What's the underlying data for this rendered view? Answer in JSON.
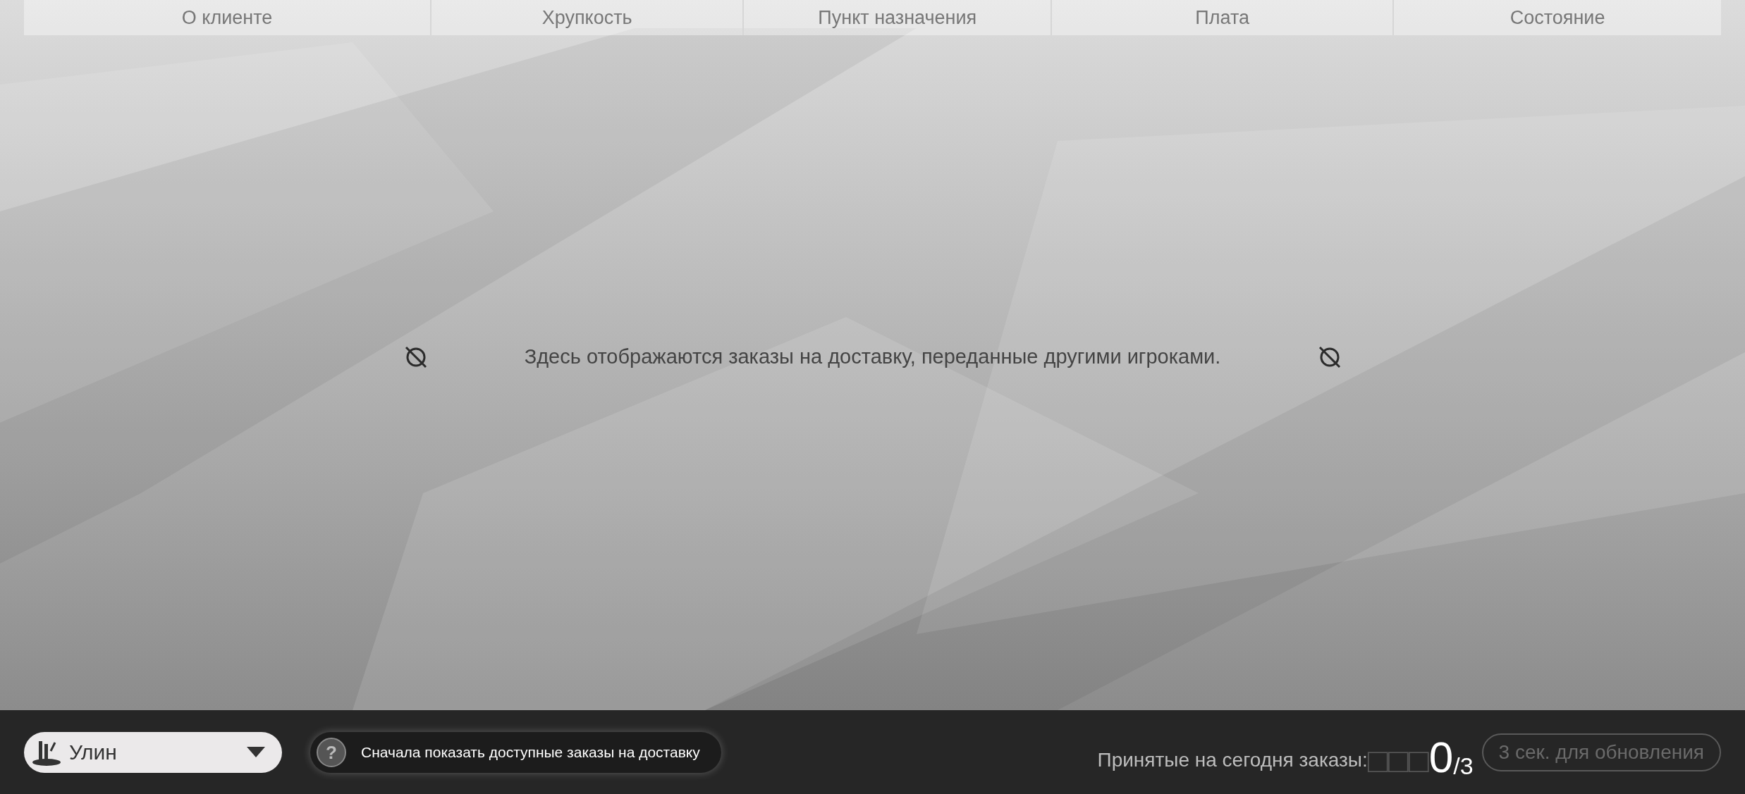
{
  "table": {
    "columns": [
      {
        "label": "О клиенте"
      },
      {
        "label": "Хрупкость"
      },
      {
        "label": "Пункт назначения"
      },
      {
        "label": "Плата"
      },
      {
        "label": "Состояние"
      }
    ]
  },
  "empty_message": {
    "text": "Здесь отображаются заказы на доставку, переданные другими игроками."
  },
  "bottom_bar": {
    "dropdown": {
      "value": "Улин"
    },
    "hint": {
      "icon": "?",
      "text": "Сначала показать доступные заказы на доставку"
    },
    "orders_today": {
      "label": "Принятые на сегодня заказы:",
      "missing_digits": "□□□",
      "count": "0",
      "limit": "/3"
    },
    "refresh_button": {
      "label": "3 сек. для обновления",
      "disabled": true
    }
  }
}
